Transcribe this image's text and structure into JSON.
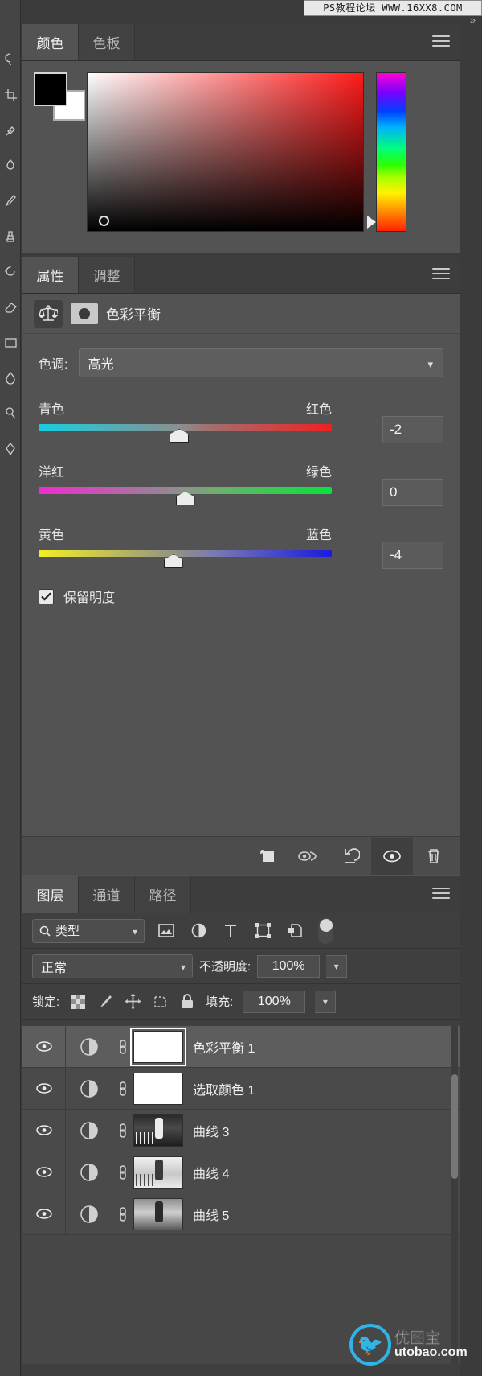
{
  "watermarks": {
    "top": "PS教程论坛 WWW.16XX8.COM",
    "bottom_cn": "优图宝",
    "bottom_en": "utobao.com"
  },
  "topbar": {
    "collapse_left": "«",
    "collapse_right": "»"
  },
  "toolbar": {
    "tools": [
      {
        "name": "lasso-tool"
      },
      {
        "name": "crop-tool"
      },
      {
        "name": "eyedropper-tool"
      },
      {
        "name": "healing-brush-tool"
      },
      {
        "name": "brush-tool"
      },
      {
        "name": "clone-stamp-tool"
      },
      {
        "name": "history-brush-tool"
      },
      {
        "name": "eraser-tool"
      },
      {
        "name": "gradient-tool"
      },
      {
        "name": "blur-tool"
      },
      {
        "name": "dodge-tool"
      },
      {
        "name": "pen-tool"
      }
    ]
  },
  "color_panel": {
    "tabs": [
      {
        "label": "颜色",
        "active": true
      },
      {
        "label": "色板",
        "active": false
      }
    ],
    "foreground_color": "#000000",
    "background_color": "#ffffff",
    "field_hue": "#ff1a1a"
  },
  "properties_panel": {
    "tabs": [
      {
        "label": "属性",
        "active": true
      },
      {
        "label": "调整",
        "active": false
      }
    ],
    "adjustment_title": "色彩平衡",
    "tone_label": "色调:",
    "tone_value": "高光",
    "sliders": [
      {
        "left_label": "青色",
        "right_label": "红色",
        "value": "-2",
        "knob_pct": 48
      },
      {
        "left_label": "洋红",
        "right_label": "绿色",
        "value": "0",
        "knob_pct": 50
      },
      {
        "left_label": "黄色",
        "right_label": "蓝色",
        "value": "-4",
        "knob_pct": 46
      }
    ],
    "preserve_luminosity_label": "保留明度",
    "preserve_luminosity_checked": true,
    "footer_buttons": [
      {
        "name": "clip-to-layer-icon"
      },
      {
        "name": "toggle-previous-state-icon"
      },
      {
        "name": "reset-icon"
      },
      {
        "name": "visibility-eye-icon"
      },
      {
        "name": "delete-trash-icon"
      }
    ]
  },
  "layers_panel": {
    "tabs": [
      {
        "label": "图层",
        "active": true
      },
      {
        "label": "通道",
        "active": false
      },
      {
        "label": "路径",
        "active": false
      }
    ],
    "filter": {
      "kind_label": "类型",
      "icons": [
        "pixel-layer-filter-icon",
        "adjustment-layer-filter-icon",
        "type-layer-filter-icon",
        "shape-layer-filter-icon",
        "smart-object-filter-icon"
      ],
      "toggle_on": true
    },
    "blend_mode": "正常",
    "opacity_label": "不透明度:",
    "opacity_value": "100%",
    "lock_label": "锁定:",
    "lock_icons": [
      "lock-transparent-pixels-icon",
      "lock-image-pixels-icon",
      "lock-position-icon",
      "lock-artboard-nesting-icon",
      "lock-all-icon"
    ],
    "fill_label": "填充:",
    "fill_value": "100%",
    "layers": [
      {
        "name": "色彩平衡 1",
        "selected": true,
        "thumb": "white",
        "visible": true
      },
      {
        "name": "选取颜色 1",
        "selected": false,
        "thumb": "white",
        "visible": true
      },
      {
        "name": "曲线 3",
        "selected": false,
        "thumb": "dark",
        "visible": true
      },
      {
        "name": "曲线 4",
        "selected": false,
        "thumb": "light",
        "visible": true
      },
      {
        "name": "曲线 5",
        "selected": false,
        "thumb": "mid",
        "visible": true
      }
    ]
  }
}
